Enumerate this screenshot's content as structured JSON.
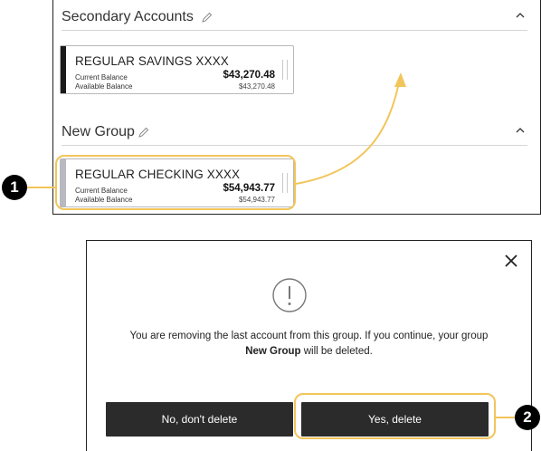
{
  "groups": [
    {
      "title": "Secondary Accounts",
      "account": {
        "name": "REGULAR SAVINGS XXXX",
        "current_label": "Current Balance",
        "current_value": "$43,270.48",
        "available_label": "Available Balance",
        "available_value": "$43,270.48",
        "stripe_color": "#1a1a1a"
      }
    },
    {
      "title": "New Group",
      "account": {
        "name": "REGULAR CHECKING XXXX",
        "current_label": "Current Balance",
        "current_value": "$54,943.77",
        "available_label": "Available Balance",
        "available_value": "$54,943.77",
        "stripe_color": "#b9b9c2"
      }
    }
  ],
  "modal": {
    "message_part1": "You are removing the last account from this group. If you continue, your group",
    "group_name": "New Group",
    "message_part2": " will be deleted.",
    "cancel_label": "No, don't delete",
    "confirm_label": "Yes, delete"
  },
  "callouts": [
    "1",
    "2"
  ],
  "colors": {
    "callout": "#f2c55a",
    "button": "#2b2b2b",
    "badge": "#000000"
  },
  "icons": [
    "pencil-icon",
    "chevron-up-icon",
    "close-icon",
    "alert-circle-icon",
    "drag-handle-icon"
  ]
}
